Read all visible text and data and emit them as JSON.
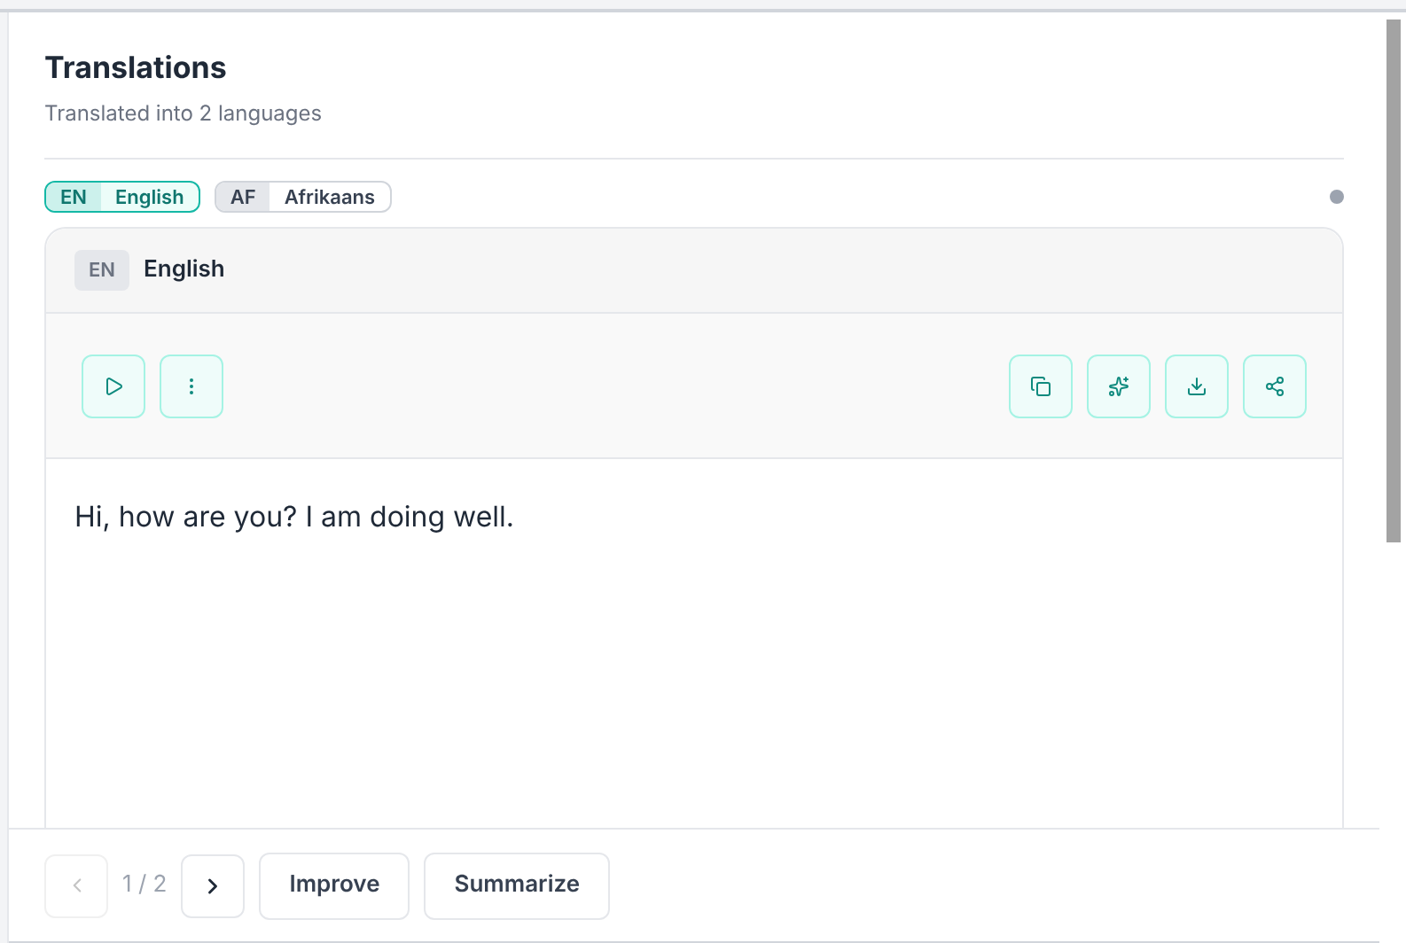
{
  "header": {
    "title": "Translations",
    "subtitle": "Translated into 2 languages"
  },
  "tabs": [
    {
      "code": "EN",
      "label": "English",
      "selected": true
    },
    {
      "code": "AF",
      "label": "Afrikaans",
      "selected": false
    }
  ],
  "card": {
    "code": "EN",
    "language": "English",
    "text": "Hi, how are you? I am doing well."
  },
  "toolbar": {
    "left": [
      {
        "kind": "play"
      },
      {
        "kind": "more"
      }
    ],
    "right": [
      {
        "kind": "copy"
      },
      {
        "kind": "sparkle"
      },
      {
        "kind": "download"
      },
      {
        "kind": "share"
      }
    ]
  },
  "footer": {
    "prev_disabled": true,
    "page": "1 / 2",
    "next_disabled": false,
    "actions": [
      "Improve",
      "Summarize"
    ]
  }
}
